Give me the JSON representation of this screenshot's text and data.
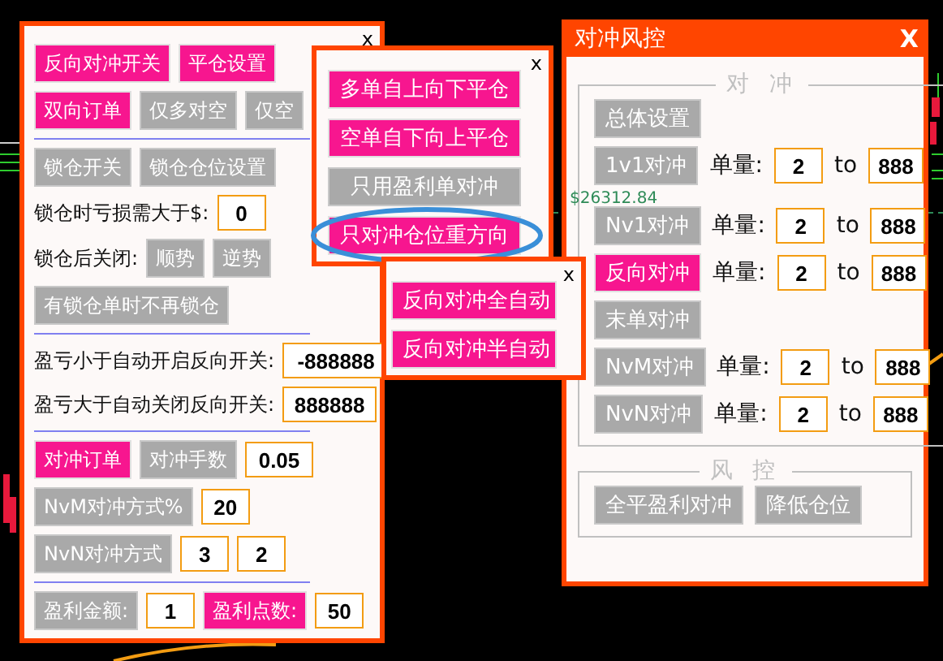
{
  "chart": {
    "price_label": "$26312.84"
  },
  "left_panel": {
    "close": "x",
    "sections": [
      [
        [
          {
            "kind": "button",
            "label": "反向对冲开关",
            "on": true
          },
          {
            "kind": "button",
            "label": "平仓设置",
            "on": true
          }
        ],
        [
          {
            "kind": "button",
            "label": "双向订单",
            "on": true
          },
          {
            "kind": "button",
            "label": "仅多对空",
            "on": false
          },
          {
            "kind": "button",
            "label": "仅空",
            "on": false
          }
        ]
      ],
      [
        [
          {
            "kind": "button",
            "label": "锁仓开关",
            "on": false
          },
          {
            "kind": "button",
            "label": "锁仓仓位设置",
            "on": false
          }
        ],
        [
          {
            "kind": "label",
            "text": "锁仓时亏损需大于$:"
          },
          {
            "kind": "input",
            "value": "0"
          }
        ],
        [
          {
            "kind": "label",
            "text": "锁仓后关闭:"
          },
          {
            "kind": "button",
            "label": "顺势",
            "on": false
          },
          {
            "kind": "button",
            "label": "逆势",
            "on": false
          }
        ],
        [
          {
            "kind": "button",
            "label": "有锁仓单时不再锁仓",
            "on": false
          }
        ]
      ],
      [
        [
          {
            "kind": "label",
            "text": "盈亏小于自动开启反向开关:"
          },
          {
            "kind": "input",
            "value": "-888888"
          }
        ],
        [
          {
            "kind": "label",
            "text": "盈亏大于自动关闭反向开关:"
          },
          {
            "kind": "input",
            "value": "888888"
          }
        ]
      ],
      [
        [
          {
            "kind": "button",
            "label": "对冲订单",
            "on": true
          },
          {
            "kind": "button",
            "label": "对冲手数",
            "on": false
          },
          {
            "kind": "input",
            "value": "0.05"
          }
        ],
        [
          {
            "kind": "button",
            "label": "NvM对冲方式%",
            "on": false
          },
          {
            "kind": "input",
            "value": "20"
          }
        ],
        [
          {
            "kind": "button",
            "label": "NvN对冲方式",
            "on": false
          },
          {
            "kind": "input",
            "value": "3"
          },
          {
            "kind": "input",
            "value": "2"
          }
        ]
      ],
      [
        [
          {
            "kind": "button",
            "label": "盈利金额:",
            "on": false
          },
          {
            "kind": "input",
            "value": "1"
          },
          {
            "kind": "button",
            "label": "盈利点数:",
            "on": true
          },
          {
            "kind": "input",
            "value": "50"
          }
        ]
      ]
    ]
  },
  "close_popup": {
    "close": "x",
    "buttons": [
      {
        "label": "多单自上向下平仓",
        "on": true,
        "highlighted": false
      },
      {
        "label": "空单自下向上平仓",
        "on": true,
        "highlighted": false
      },
      {
        "label": "只用盈利单对冲",
        "on": false,
        "highlighted": false
      },
      {
        "label": "只对冲仓位重方向",
        "on": true,
        "highlighted": true
      }
    ]
  },
  "auto_popup": {
    "close": "x",
    "buttons": [
      {
        "label": "反向对冲全自动",
        "on": true,
        "highlighted": false
      },
      {
        "label": "反向对冲半自动",
        "on": true,
        "highlighted": false
      }
    ]
  },
  "risk_panel": {
    "title": "对冲风控",
    "close": "X",
    "groups": [
      {
        "legend": "对 冲",
        "rows": [
          [
            {
              "kind": "button",
              "label": "总体设置",
              "on": false
            }
          ],
          [
            {
              "kind": "button",
              "label": "1v1对冲",
              "on": false
            },
            {
              "kind": "label",
              "text": "单量:"
            },
            {
              "kind": "input",
              "value": "2"
            },
            {
              "kind": "label",
              "text": "to"
            },
            {
              "kind": "input",
              "value": "888"
            }
          ],
          [
            {
              "kind": "button",
              "label": "Nv1对冲",
              "on": false
            },
            {
              "kind": "label",
              "text": "单量:"
            },
            {
              "kind": "input",
              "value": "2"
            },
            {
              "kind": "label",
              "text": "to"
            },
            {
              "kind": "input",
              "value": "888"
            }
          ],
          [
            {
              "kind": "button",
              "label": "反向对冲",
              "on": true
            },
            {
              "kind": "label",
              "text": "单量:"
            },
            {
              "kind": "input",
              "value": "2"
            },
            {
              "kind": "label",
              "text": "to"
            },
            {
              "kind": "input",
              "value": "888"
            }
          ],
          [
            {
              "kind": "button",
              "label": "末单对冲",
              "on": false
            }
          ],
          [
            {
              "kind": "button",
              "label": "NvM对冲",
              "on": false
            },
            {
              "kind": "label",
              "text": "单量:"
            },
            {
              "kind": "input",
              "value": "2"
            },
            {
              "kind": "label",
              "text": "to"
            },
            {
              "kind": "input",
              "value": "888"
            }
          ],
          [
            {
              "kind": "button",
              "label": "NvN对冲",
              "on": false
            },
            {
              "kind": "label",
              "text": "单量:"
            },
            {
              "kind": "input",
              "value": "2"
            },
            {
              "kind": "label",
              "text": "to"
            },
            {
              "kind": "input",
              "value": "888"
            }
          ]
        ]
      },
      {
        "legend": "风 控",
        "rows": [
          [
            {
              "kind": "button",
              "label": "全平盈利对冲",
              "on": false
            },
            {
              "kind": "button",
              "label": "降低仓位",
              "on": false
            }
          ]
        ]
      }
    ]
  }
}
